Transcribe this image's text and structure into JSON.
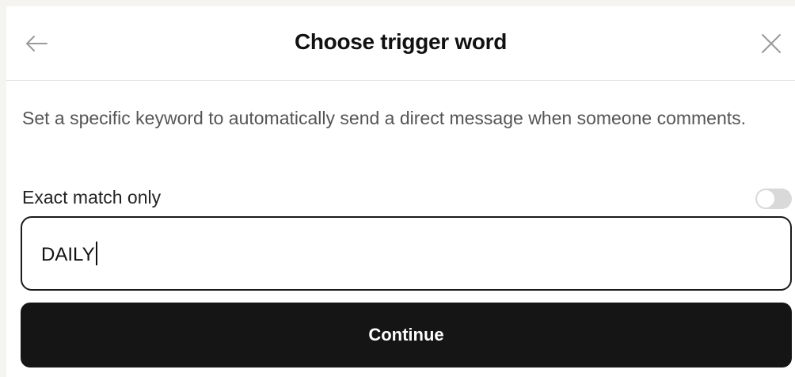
{
  "header": {
    "title": "Choose trigger word",
    "back_icon": "arrow-left-icon",
    "close_icon": "close-icon"
  },
  "description": "Set a specific keyword to automatically send a direct message when someone comments.",
  "exact_match": {
    "label": "Exact match only",
    "enabled": false
  },
  "keyword_input": {
    "value": "DAILY"
  },
  "continue_button": {
    "label": "Continue"
  },
  "colors": {
    "primary_button": "#151515",
    "toggle_off": "#d9d9d9",
    "background": "#f5f4f1"
  }
}
